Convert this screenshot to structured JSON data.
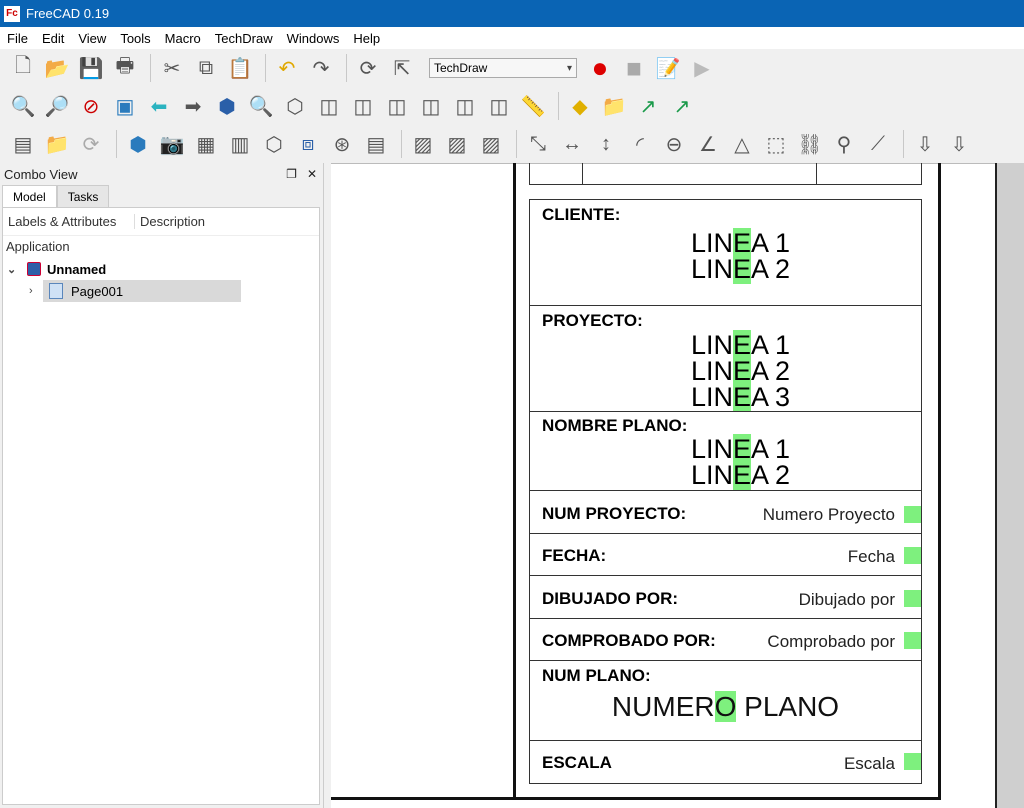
{
  "window": {
    "title": "FreeCAD 0.19"
  },
  "menu": [
    "File",
    "Edit",
    "View",
    "Tools",
    "Macro",
    "TechDraw",
    "Windows",
    "Help"
  ],
  "workbench": {
    "selected": "TechDraw"
  },
  "combo_view": {
    "title": "Combo View",
    "tabs": [
      "Model",
      "Tasks"
    ],
    "columns": [
      "Labels & Attributes",
      "Description"
    ],
    "section": "Application",
    "document": "Unnamed",
    "page": "Page001"
  },
  "title_block": {
    "cliente": {
      "label": "CLIENTE:",
      "lines": [
        "LIN",
        "A 1",
        "LIN",
        "A 2"
      ]
    },
    "proyecto_label": "PROYECTO:",
    "nombre_plano_label": "NOMBRE PLANO:",
    "line_prefix": "LIN",
    "line_hl": "E",
    "l1": "A 1",
    "l2": "A 2",
    "l3": "A 3",
    "num_proyecto": {
      "label": "NUM PROYECTO:",
      "value": "Numero Proyecto"
    },
    "fecha": {
      "label": "FECHA:",
      "value": "Fecha"
    },
    "dibujado": {
      "label": "DIBUJADO POR:",
      "value": "Dibujado por"
    },
    "comprobado": {
      "label": "COMPROBADO POR:",
      "value": "Comprobado por"
    },
    "num_plano": {
      "label": "NUM PLANO:",
      "value_pre": "NUMER",
      "value_hl": "O",
      "value_post": " PLANO"
    },
    "escala": {
      "label": "ESCALA",
      "value": "Escala"
    }
  }
}
